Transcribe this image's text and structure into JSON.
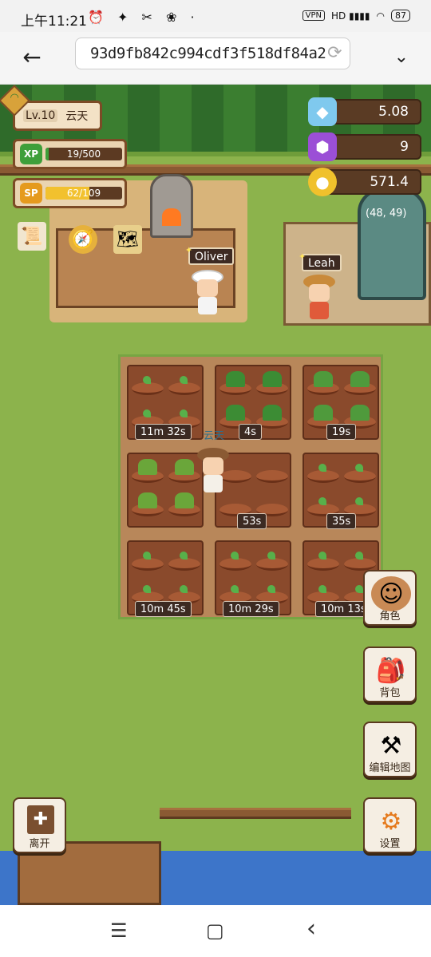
{
  "status_bar": {
    "time": "上午11:21",
    "icons_left": "⏰ ✦ ✂ ❀ ·",
    "vpn": "VPN",
    "signal": "HD ▮▮▮▮",
    "wifi": "◠",
    "battery": "87"
  },
  "browser": {
    "url": "93d9fb842c994cdf3f518df84a2",
    "back_icon": "←",
    "reload_icon": "⟳",
    "menu_icon": "⌄"
  },
  "player": {
    "level": "Lv.10",
    "name": "云天",
    "xp_badge": "XP",
    "xp_text": "19/500",
    "xp_fraction": 0.038,
    "sp_badge": "SP",
    "sp_text": "62/109",
    "sp_fraction": 0.569,
    "wifi_icon": "wifi-icon"
  },
  "resources": {
    "crystal": "5.08",
    "gem": "9",
    "coin": "571.4"
  },
  "npcs": {
    "chef": "Oliver",
    "farmer": "Leah"
  },
  "glasshouse": {
    "coords": "(48, 49)"
  },
  "field": {
    "player_tag": "云天",
    "timers": [
      "11m 32s",
      "4s",
      "19s",
      "",
      "53s",
      "35s",
      "10m 45s",
      "10m 29s",
      "10m 13s"
    ]
  },
  "side_menu": {
    "character": "角色",
    "backpack": "背包",
    "edit_map": "编辑地图",
    "settings": "设置",
    "leave": "离开"
  },
  "colors": {
    "grass": "#8cb34c",
    "xp_fill": "#3e9f3a",
    "sp_fill": "#f2c12e",
    "panel_border": "#7c4b26"
  },
  "nav": {
    "menu": "☰",
    "home": "▢",
    "back": "‹"
  }
}
